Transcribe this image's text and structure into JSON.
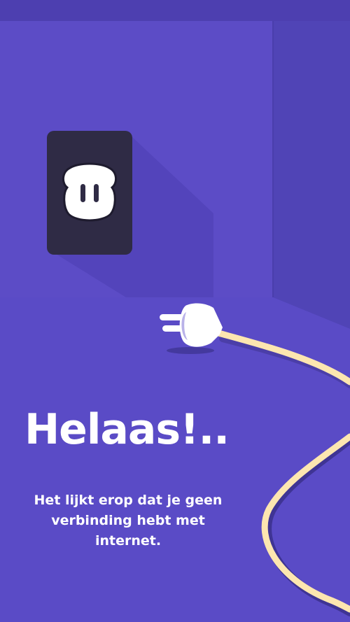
{
  "screen": {
    "title": "Helaas!..",
    "message": "Het lijkt erop dat je geen verbinding hebt met internet."
  },
  "illustration": {
    "icons": [
      "wall-socket-icon",
      "plug-icon",
      "cable-icon"
    ]
  },
  "colors": {
    "wall": "#5a4bc6",
    "wall_dark": "#4f40b2",
    "floor": "#5a4bc6",
    "status_bar": "#4d3fb0",
    "socket_plate": "#2f2b45",
    "socket_face": "#ffffff",
    "cable": "#fde6b0",
    "cable_shadow": "#3f3494",
    "text": "#ffffff"
  }
}
